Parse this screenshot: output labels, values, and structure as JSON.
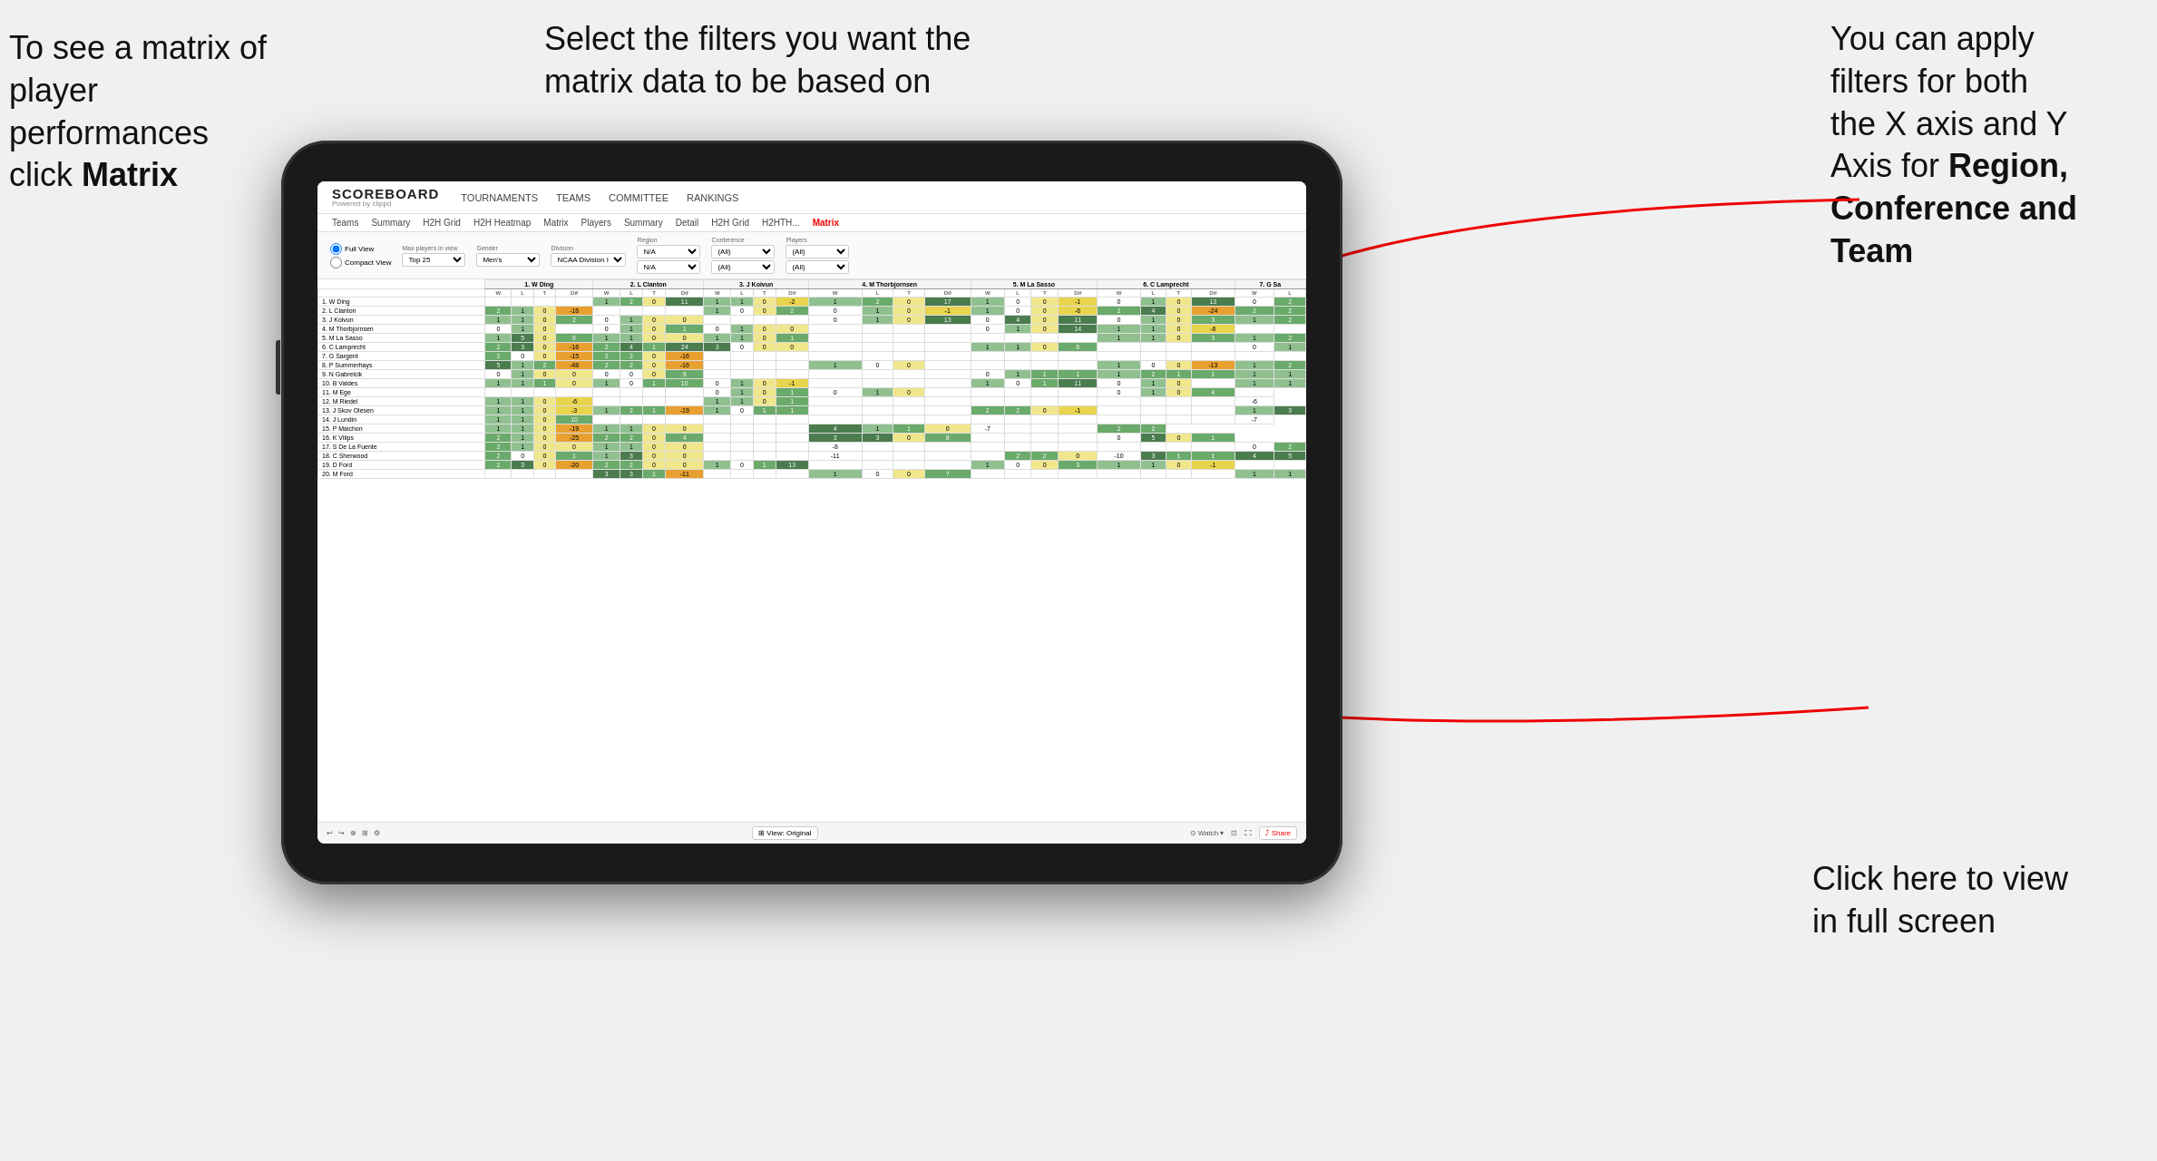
{
  "annotations": {
    "top_left": {
      "line1": "To see a matrix of",
      "line2": "player performances",
      "line3_prefix": "click ",
      "line3_bold": "Matrix"
    },
    "top_center": {
      "text": "Select the filters you want the matrix data to be based on"
    },
    "top_right": {
      "line1": "You  can apply",
      "line2": "filters for both",
      "line3": "the X axis and Y",
      "line4_prefix": "Axis for ",
      "line4_bold": "Region,",
      "line5_bold": "Conference and",
      "line6_bold": "Team"
    },
    "bottom_right": {
      "line1": "Click here to view",
      "line2": "in full screen"
    }
  },
  "nav": {
    "logo": "SCOREBOARD",
    "logo_sub": "Powered by clippd",
    "items": [
      "TOURNAMENTS",
      "TEAMS",
      "COMMITTEE",
      "RANKINGS"
    ]
  },
  "sub_nav": {
    "items": [
      "Teams",
      "Summary",
      "H2H Grid",
      "H2H Heatmap",
      "Matrix",
      "Players",
      "Summary",
      "Detail",
      "H2H Grid",
      "H2HTH...",
      "Matrix"
    ]
  },
  "filters": {
    "view_options": [
      "Full View",
      "Compact View"
    ],
    "max_players": {
      "label": "Max players in view",
      "value": "Top 25"
    },
    "gender": {
      "label": "Gender",
      "value": "Men's"
    },
    "division": {
      "label": "Division",
      "value": "NCAA Division I"
    },
    "region": {
      "label": "Region",
      "values": [
        "N/A",
        "N/A"
      ]
    },
    "conference": {
      "label": "Conference",
      "values": [
        "(All)",
        "(All)"
      ]
    },
    "players": {
      "label": "Players",
      "values": [
        "(All)",
        "(All)"
      ]
    }
  },
  "matrix": {
    "col_headers": [
      "1. W Ding",
      "2. L Clanton",
      "3. J Koivun",
      "4. M Thorbjornsen",
      "5. M La Sasso",
      "6. C Lamprecht",
      "7. G Sa"
    ],
    "sub_headers": [
      "W",
      "L",
      "T",
      "Dif"
    ],
    "rows": [
      {
        "name": "1. W Ding",
        "cells": [
          "",
          "",
          "",
          "",
          "1",
          "2",
          "0",
          "11",
          "1",
          "1",
          "0",
          "-2",
          "1",
          "2",
          "0",
          "17",
          "1",
          "0",
          "0",
          "-1",
          "0",
          "1",
          "0",
          "13",
          "0",
          "2"
        ]
      },
      {
        "name": "2. L Clanton",
        "cells": [
          "2",
          "1",
          "0",
          "-16",
          "",
          "",
          "",
          "",
          "1",
          "0",
          "0",
          "2",
          "0",
          "1",
          "0",
          "-1",
          "1",
          "0",
          "0",
          "-6",
          "2",
          "4",
          "0",
          "-24",
          "2",
          "2"
        ]
      },
      {
        "name": "3. J Koivun",
        "cells": [
          "1",
          "1",
          "0",
          "2",
          "0",
          "1",
          "0",
          "0",
          "",
          "",
          "",
          "",
          "0",
          "1",
          "0",
          "13",
          "0",
          "4",
          "0",
          "11",
          "0",
          "1",
          "0",
          "3",
          "1",
          "2"
        ]
      },
      {
        "name": "4. M Thorbjornsen",
        "cells": [
          "0",
          "1",
          "0",
          "",
          "0",
          "1",
          "0",
          "1",
          "0",
          "1",
          "0",
          "0",
          "",
          "",
          "",
          "",
          "0",
          "1",
          "0",
          "14",
          "1",
          "1",
          "0",
          "-6",
          ""
        ]
      },
      {
        "name": "5. M La Sasso",
        "cells": [
          "1",
          "5",
          "0",
          "6",
          "1",
          "1",
          "0",
          "0",
          "1",
          "1",
          "0",
          "1",
          "",
          "",
          "",
          "",
          "",
          "",
          "",
          "",
          "1",
          "1",
          "0",
          "3",
          "1",
          "2"
        ]
      },
      {
        "name": "6. C Lamprecht",
        "cells": [
          "2",
          "3",
          "0",
          "-16",
          "2",
          "4",
          "1",
          "24",
          "3",
          "0",
          "0",
          "0",
          "",
          "",
          "",
          "",
          "1",
          "1",
          "0",
          "6",
          "",
          "",
          "",
          "",
          "0",
          "1"
        ]
      },
      {
        "name": "7. G Sargent",
        "cells": [
          "2",
          "0",
          "0",
          "-15",
          "2",
          "2",
          "0",
          "-16",
          "",
          "",
          "",
          "",
          "",
          "",
          "",
          "",
          "",
          "",
          "",
          "",
          "",
          "",
          "",
          "",
          ""
        ]
      },
      {
        "name": "8. P Summerhays",
        "cells": [
          "5",
          "1",
          "2",
          "-48",
          "2",
          "2",
          "0",
          "-16",
          "",
          "",
          "",
          "",
          "1",
          "0",
          "0",
          "",
          "",
          "",
          "",
          "",
          "1",
          "0",
          "0",
          "-13",
          "1",
          "2"
        ]
      },
      {
        "name": "9. N Gabrelcik",
        "cells": [
          "0",
          "1",
          "0",
          "0",
          "0",
          "0",
          "0",
          "9",
          "",
          "",
          "",
          "",
          "",
          "",
          "",
          "",
          "0",
          "1",
          "1",
          "1",
          "1",
          "2",
          "1",
          "1",
          "1",
          "1"
        ]
      },
      {
        "name": "10. B Valdes",
        "cells": [
          "1",
          "1",
          "1",
          "0",
          "1",
          "0",
          "1",
          "10",
          "0",
          "1",
          "0",
          "-1",
          "",
          "",
          "",
          "",
          "1",
          "0",
          "1",
          "11",
          "0",
          "1",
          "0",
          "",
          "1",
          "1"
        ]
      },
      {
        "name": "11. M Ege",
        "cells": [
          "",
          "",
          "",
          "",
          "",
          "",
          "",
          "",
          "0",
          "1",
          "0",
          "1",
          "0",
          "1",
          "0",
          "",
          "",
          "",
          "",
          "",
          "0",
          "1",
          "0",
          "4",
          ""
        ]
      },
      {
        "name": "12. M Riedel",
        "cells": [
          "1",
          "1",
          "0",
          "-6",
          "",
          "",
          "",
          "",
          "1",
          "1",
          "0",
          "1",
          "",
          "",
          "",
          "",
          "",
          "",
          "",
          "",
          "",
          "",
          "",
          "",
          "-6"
        ]
      },
      {
        "name": "13. J Skov Olesen",
        "cells": [
          "1",
          "1",
          "0",
          "-3",
          "1",
          "2",
          "1",
          "-19",
          "1",
          "0",
          "1",
          "1",
          "",
          "",
          "",
          "",
          "2",
          "2",
          "0",
          "-1",
          "",
          "",
          "",
          "",
          "1",
          "3"
        ]
      },
      {
        "name": "14. J Lundin",
        "cells": [
          "1",
          "1",
          "0",
          "10",
          "",
          "",
          "",
          "",
          "",
          "",
          "",
          "",
          "",
          "",
          "",
          "",
          "",
          "",
          "",
          "",
          "",
          "",
          "",
          "",
          "-7"
        ]
      },
      {
        "name": "15. P Maichon",
        "cells": [
          "1",
          "1",
          "0",
          "-19",
          "1",
          "1",
          "0",
          "0",
          "",
          "",
          "",
          "",
          "4",
          "1",
          "1",
          "0",
          "-7",
          "",
          "",
          "",
          "2",
          "2"
        ]
      },
      {
        "name": "16. K Vilips",
        "cells": [
          "2",
          "1",
          "0",
          "-25",
          "2",
          "2",
          "0",
          "4",
          "",
          "",
          "",
          "",
          "3",
          "3",
          "0",
          "8",
          "",
          "",
          "",
          "",
          "0",
          "5",
          "0",
          "1"
        ]
      },
      {
        "name": "17. S De La Fuente",
        "cells": [
          "2",
          "1",
          "0",
          "0",
          "1",
          "1",
          "0",
          "0",
          "",
          "",
          "",
          "",
          "-8",
          "",
          "",
          "",
          "",
          "",
          "",
          "",
          "",
          "",
          "",
          "",
          "0",
          "2"
        ]
      },
      {
        "name": "18. C Sherwood",
        "cells": [
          "2",
          "0",
          "0",
          "1",
          "1",
          "3",
          "0",
          "0",
          "",
          "",
          "",
          "",
          "-11",
          "",
          "",
          "",
          "",
          "2",
          "2",
          "0",
          "-10",
          "3",
          "1",
          "1",
          "4",
          "5"
        ]
      },
      {
        "name": "19. D Ford",
        "cells": [
          "2",
          "3",
          "0",
          "-20",
          "2",
          "2",
          "0",
          "0",
          "1",
          "0",
          "1",
          "13",
          "",
          "",
          "",
          "",
          "1",
          "0",
          "0",
          "3",
          "1",
          "1",
          "0",
          "-1",
          ""
        ]
      },
      {
        "name": "20. M Ford",
        "cells": [
          "",
          "",
          "",
          "",
          "3",
          "3",
          "1",
          "-11",
          "",
          "",
          "",
          "",
          "1",
          "0",
          "0",
          "7",
          "",
          "",
          "",
          "",
          "",
          "",
          "",
          "",
          "1",
          "1"
        ]
      }
    ]
  },
  "toolbar": {
    "undo": "↩",
    "redo": "↪",
    "view_original": "⊞ View: Original",
    "watch": "⊙ Watch ▾",
    "share": "⤴ Share"
  },
  "colors": {
    "red_arrow": "#e00",
    "accent": "#e00"
  }
}
